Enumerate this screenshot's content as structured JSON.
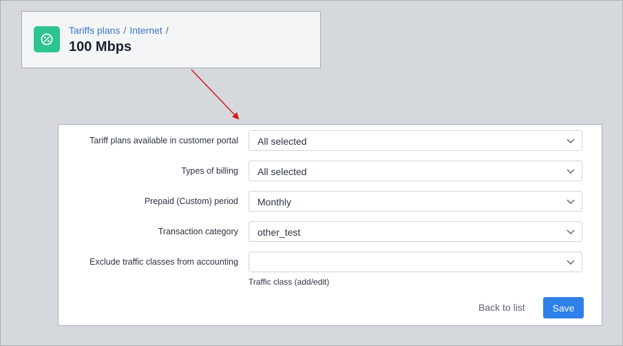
{
  "header": {
    "breadcrumb": [
      "Tariffs plans",
      "Internet"
    ],
    "separator": "/",
    "title": "100 Mbps",
    "icon": "tariff-percent-icon",
    "icon_color": "#2ec48e"
  },
  "form": {
    "rows": [
      {
        "label": "Tariff plans available in customer portal",
        "value": "All selected"
      },
      {
        "label": "Types of billing",
        "value": "All selected"
      },
      {
        "label": "Prepaid (Custom) period",
        "value": "Monthly"
      },
      {
        "label": "Transaction category",
        "value": "other_test"
      },
      {
        "label": "Exclude traffic classes from accounting",
        "value": ""
      }
    ],
    "helper_link": "Traffic class (add/edit)"
  },
  "actions": {
    "back_label": "Back to list",
    "save_label": "Save",
    "save_color": "#2f80e8"
  },
  "annotation": {
    "arrow_color": "#d11a1a"
  }
}
